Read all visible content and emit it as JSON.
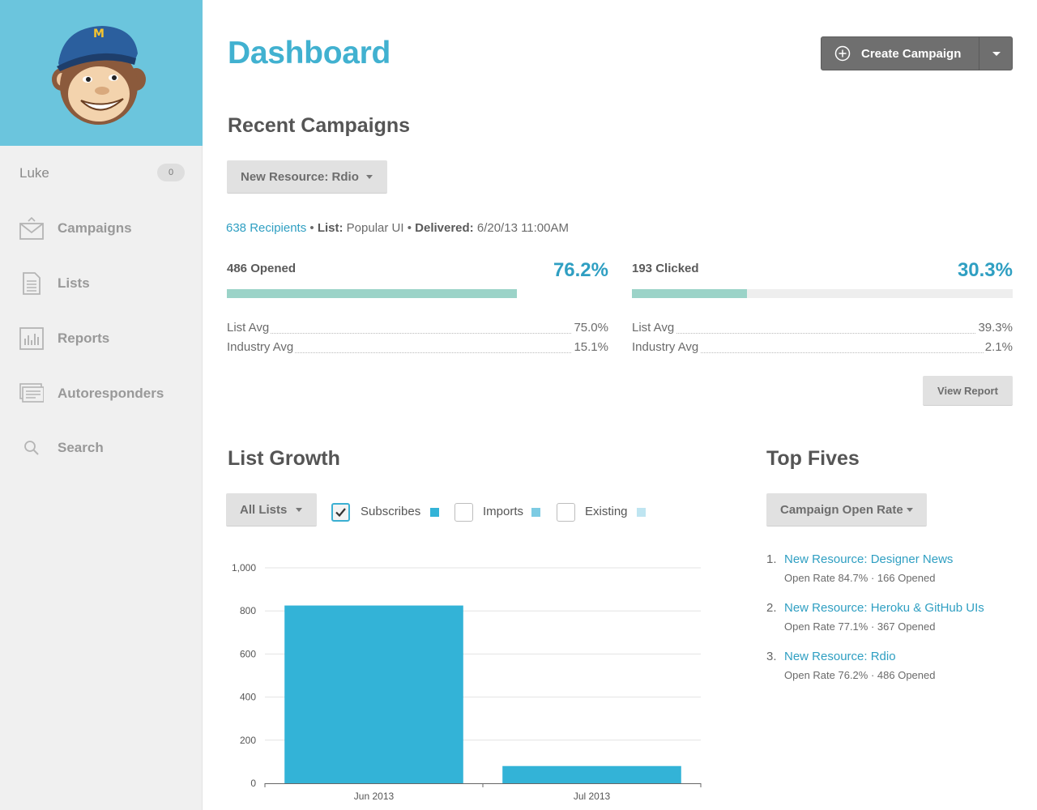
{
  "sidebar": {
    "user": {
      "name": "Luke",
      "badge": "0"
    },
    "items": [
      {
        "label": "Campaigns",
        "icon": "campaigns-envelope-icon"
      },
      {
        "label": "Lists",
        "icon": "lists-document-icon"
      },
      {
        "label": "Reports",
        "icon": "reports-chart-icon"
      },
      {
        "label": "Autoresponders",
        "icon": "autoresponders-icon"
      },
      {
        "label": "Search",
        "icon": "search-icon"
      }
    ]
  },
  "header": {
    "title": "Dashboard",
    "create_label": "Create Campaign"
  },
  "recent": {
    "heading": "Recent Campaigns",
    "campaign_select": "New Resource: Rdio",
    "recipients": "638 Recipients",
    "list_label": "List:",
    "list_value": "Popular UI",
    "delivered_label": "Delivered:",
    "delivered_value": "6/20/13 11:00AM",
    "opened": {
      "label": "486 Opened",
      "pct": "76.2%",
      "rate": 0.762,
      "list_avg_label": "List Avg",
      "list_avg": "75.0%",
      "industry_avg_label": "Industry Avg",
      "industry_avg": "15.1%"
    },
    "clicked": {
      "label": "193 Clicked",
      "pct": "30.3%",
      "rate": 0.303,
      "list_avg_label": "List Avg",
      "list_avg": "39.3%",
      "industry_avg_label": "Industry Avg",
      "industry_avg": "2.1%"
    },
    "view_report": "View Report"
  },
  "growth": {
    "heading": "List Growth",
    "list_select": "All Lists",
    "filters": [
      {
        "label": "Subscribes",
        "checked": true,
        "color": "#33b3d7"
      },
      {
        "label": "Imports",
        "checked": false,
        "color": "#7dcbe3"
      },
      {
        "label": "Existing",
        "checked": false,
        "color": "#bfe5f1"
      }
    ]
  },
  "chart_data": {
    "type": "bar",
    "categories": [
      "Jun 2013",
      "Jul 2013"
    ],
    "series": [
      {
        "name": "Subscribes",
        "values": [
          825,
          80
        ],
        "color": "#33b3d7"
      }
    ],
    "yticks": [
      "0",
      "200",
      "400",
      "600",
      "800",
      "1,000"
    ],
    "ylim": [
      0,
      1000
    ],
    "grid": true,
    "title": "",
    "xlabel": "",
    "ylabel": ""
  },
  "top_fives": {
    "heading": "Top Fives",
    "select": "Campaign Open Rate",
    "items": [
      {
        "num": "1.",
        "title": "New Resource: Designer News",
        "sub": "Open Rate 84.7% · 166 Opened"
      },
      {
        "num": "2.",
        "title": "New Resource: Heroku & GitHub UIs",
        "sub": "Open Rate 77.1% · 367 Opened"
      },
      {
        "num": "3.",
        "title": "New Resource: Rdio",
        "sub": "Open Rate 76.2% · 486 Opened"
      }
    ]
  }
}
